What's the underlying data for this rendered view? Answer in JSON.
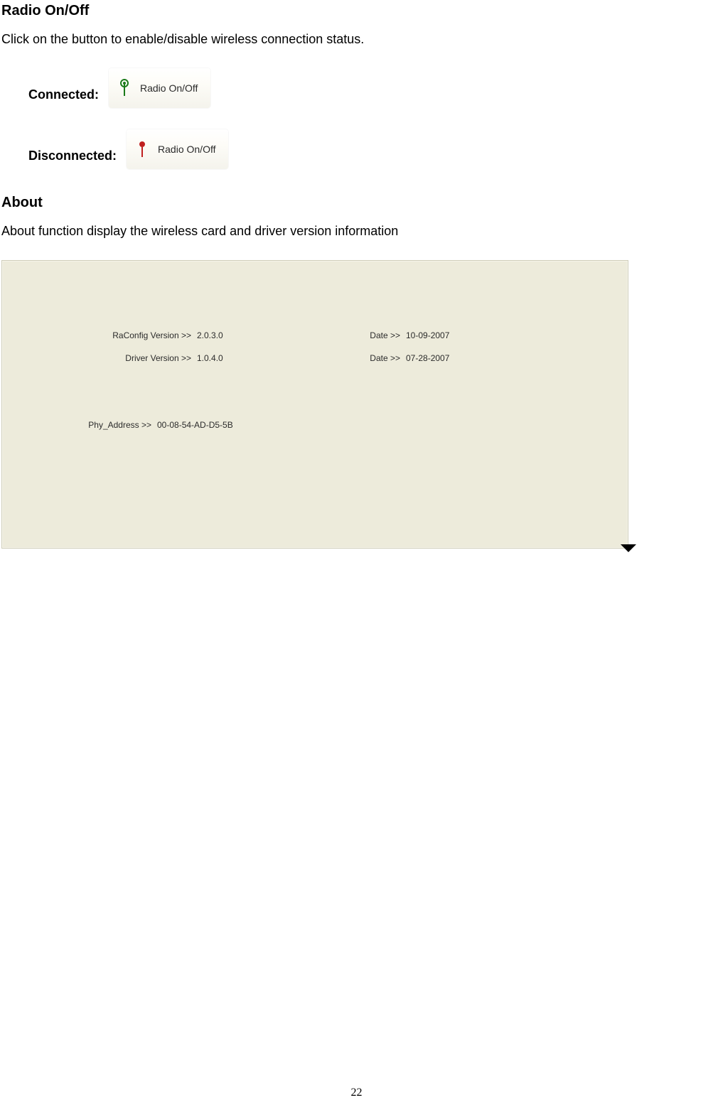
{
  "headings": {
    "radio": "Radio On/Off",
    "about": "About"
  },
  "text": {
    "radio_desc": "Click on the button to enable/disable wireless connection status.",
    "about_desc": "About function display the wireless card and driver version information",
    "connected_label": "Connected:",
    "disconnected_label": "Disconnected:",
    "radio_btn_label": "Radio On/Off"
  },
  "about_panel": {
    "raconfig_label": "RaConfig Version >>",
    "raconfig_value": "2.0.3.0",
    "raconfig_date_label": "Date >>",
    "raconfig_date_value": "10-09-2007",
    "driver_label": "Driver Version >>",
    "driver_value": "1.0.4.0",
    "driver_date_label": "Date >>",
    "driver_date_value": "07-28-2007",
    "phy_label": "Phy_Address >>",
    "phy_value": "00-08-54-AD-D5-5B"
  },
  "page_number": "22"
}
